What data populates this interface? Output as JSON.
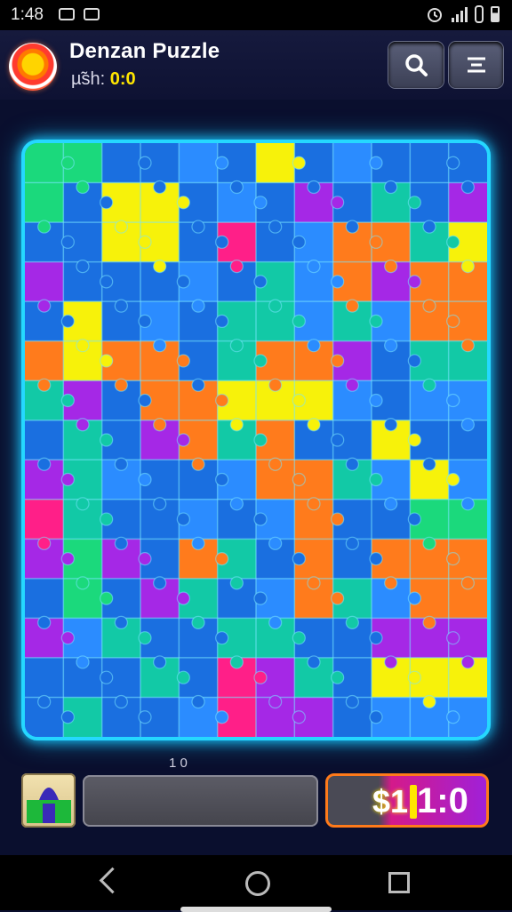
{
  "status_bar": {
    "time": "1:48",
    "battery_text": "",
    "icons": [
      "gallery-icon",
      "mask-icon",
      "alarm-icon",
      "signal-icon",
      "battery-icon"
    ]
  },
  "header": {
    "app_title": "Denzan Puzzle",
    "score_label": "µ̃sh:",
    "score_value": "0:0",
    "search_icon": "search-icon",
    "menu_icon": "menu-icon"
  },
  "board": {
    "columns": 12,
    "rows": 15,
    "palette": {
      "B": "#1a6fe0",
      "b": "#2b8cff",
      "T": "#12c9a6",
      "G": "#1bd97c",
      "Y": "#f7f20a",
      "O": "#ff7b1c",
      "P": "#a528e6",
      "M": "#ff1f88",
      "L": "#33a3ff"
    },
    "tiles": [
      "GGBBbBYBbBBB",
      "GBYYBbBPBTBP",
      "BBYYBMBbOOTY",
      "PBBBbBTbOPOO",
      "BYBbBTTbTbOO",
      "OYOOBTOOPBTT",
      "TPBOOYYYbBbb",
      "BTBPOTOBBYBB",
      "PTbBBbOOTbYb",
      "MTBBbBbOBBGG",
      "PGPBOTBOBOOO",
      "BGBPTBbOTbOO",
      "PbTBBTTBBPPP",
      "BBBTBMPTBYYY",
      "BTBBbMPPBbbb"
    ]
  },
  "footer": {
    "move_count": "1 0",
    "progress_label": "",
    "timer_icon_text": "$1",
    "timer_value": "1:0"
  },
  "nav": {
    "back_icon": "back-icon",
    "home_icon": "home-icon",
    "recent_icon": "recent-apps-icon"
  }
}
